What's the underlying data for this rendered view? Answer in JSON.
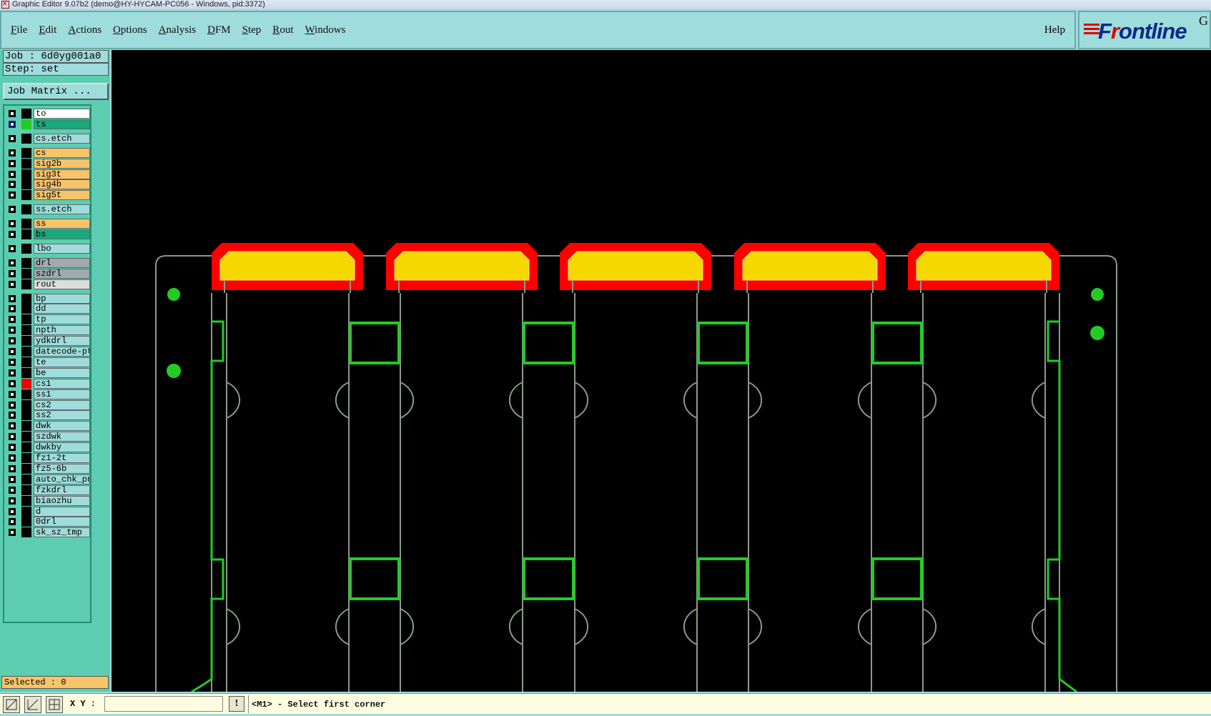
{
  "window": {
    "title": "Graphic Editor 9.07b2 (demo@HY-HYCAM-PC056 - Windows, pid:3372)"
  },
  "menubar": {
    "items": [
      "File",
      "Edit",
      "Actions",
      "Options",
      "Analysis",
      "DFM",
      "Step",
      "Rout",
      "Windows"
    ],
    "help": "Help"
  },
  "logo": {
    "text_pre": "F",
    "text_r": "r",
    "text_post": "ontline",
    "superscript": "G"
  },
  "panel": {
    "job": "Job : 6d0yg001a0",
    "step": "Step: set",
    "job_matrix": "Job Matrix ...",
    "selected": "Selected : 0"
  },
  "layers": [
    {
      "name": "to",
      "color": "#ffffff",
      "swatch": "#000000",
      "selected": false
    },
    {
      "name": "ts",
      "color": "#1aa87c",
      "swatch": "#22cc22",
      "selected": true
    },
    {
      "name": "cs.etch",
      "color": "#9fdcdc",
      "swatch": "#000000",
      "selected": false
    },
    {
      "name": "cs",
      "color": "#f8c46a",
      "swatch": "#000000",
      "selected": false
    },
    {
      "name": "sig2b",
      "color": "#f8c46a",
      "swatch": "#000000",
      "selected": false
    },
    {
      "name": "sig3t",
      "color": "#f8c46a",
      "swatch": "#000000",
      "selected": false
    },
    {
      "name": "sig4b",
      "color": "#f8c46a",
      "swatch": "#000000",
      "selected": false
    },
    {
      "name": "sig5t",
      "color": "#f8c46a",
      "swatch": "#000000",
      "selected": false
    },
    {
      "name": "ss.etch",
      "color": "#9fdcdc",
      "swatch": "#000000",
      "selected": false
    },
    {
      "name": "ss",
      "color": "#f8c46a",
      "swatch": "#000000",
      "selected": false
    },
    {
      "name": "bs",
      "color": "#1aa87c",
      "swatch": "#000000",
      "selected": false
    },
    {
      "name": "lbo",
      "color": "#9fdcdc",
      "swatch": "#000000",
      "selected": false
    },
    {
      "name": "drl",
      "color": "#a0aab0",
      "swatch": "#000000",
      "selected": false
    },
    {
      "name": "szdrl",
      "color": "#a0aab0",
      "swatch": "#000000",
      "selected": false
    },
    {
      "name": "rout",
      "color": "#dddddd",
      "swatch": "#000000",
      "selected": false
    },
    {
      "name": "bp",
      "color": "#9fdcdc",
      "swatch": "#000000",
      "selected": false
    },
    {
      "name": "dd",
      "color": "#9fdcdc",
      "swatch": "#000000",
      "selected": false
    },
    {
      "name": "tp",
      "color": "#9fdcdc",
      "swatch": "#000000",
      "selected": false
    },
    {
      "name": "npth",
      "color": "#9fdcdc",
      "swatch": "#000000",
      "selected": false
    },
    {
      "name": "ydkdrl",
      "color": "#9fdcdc",
      "swatch": "#000000",
      "selected": false
    },
    {
      "name": "datecode-pt",
      "color": "#9fdcdc",
      "swatch": "#000000",
      "selected": false
    },
    {
      "name": "te",
      "color": "#9fdcdc",
      "swatch": "#000000",
      "selected": false
    },
    {
      "name": "be",
      "color": "#9fdcdc",
      "swatch": "#000000",
      "selected": false
    },
    {
      "name": "cs1",
      "color": "#9fdcdc",
      "swatch": "#ee0000",
      "selected": false
    },
    {
      "name": "ss1",
      "color": "#9fdcdc",
      "swatch": "#000000",
      "selected": false
    },
    {
      "name": "cs2",
      "color": "#9fdcdc",
      "swatch": "#000000",
      "selected": false
    },
    {
      "name": "ss2",
      "color": "#9fdcdc",
      "swatch": "#000000",
      "selected": false
    },
    {
      "name": "dwk",
      "color": "#9fdcdc",
      "swatch": "#000000",
      "selected": false
    },
    {
      "name": "szdwk",
      "color": "#9fdcdc",
      "swatch": "#000000",
      "selected": false
    },
    {
      "name": "dwkby",
      "color": "#9fdcdc",
      "swatch": "#000000",
      "selected": false
    },
    {
      "name": "fz1-2t",
      "color": "#9fdcdc",
      "swatch": "#000000",
      "selected": false
    },
    {
      "name": "fz5-6b",
      "color": "#9fdcdc",
      "swatch": "#000000",
      "selected": false
    },
    {
      "name": "auto_chk_pn",
      "color": "#9fdcdc",
      "swatch": "#000000",
      "selected": false
    },
    {
      "name": "fzkdrl",
      "color": "#9fdcdc",
      "swatch": "#000000",
      "selected": false
    },
    {
      "name": "biaozhu",
      "color": "#9fdcdc",
      "swatch": "#000000",
      "selected": false
    },
    {
      "name": "d",
      "color": "#9fdcdc",
      "swatch": "#000000",
      "selected": false
    },
    {
      "name": "0drl",
      "color": "#9fdcdc",
      "swatch": "#000000",
      "selected": false
    },
    {
      "name": "sk_sz_tmp",
      "color": "#9fdcdc",
      "swatch": "#000000",
      "selected": false
    }
  ],
  "canvas": {
    "background": "#000000",
    "pad_outer_color": "#ff0000",
    "pad_inner_color": "#f5d800",
    "board_outline_color": "#8a9a8a",
    "ts_color": "#22cc22"
  },
  "bottom": {
    "xy_label": "X Y :",
    "xy_value": "",
    "info_icon": "!",
    "status": "<M1> - Select first corner"
  }
}
